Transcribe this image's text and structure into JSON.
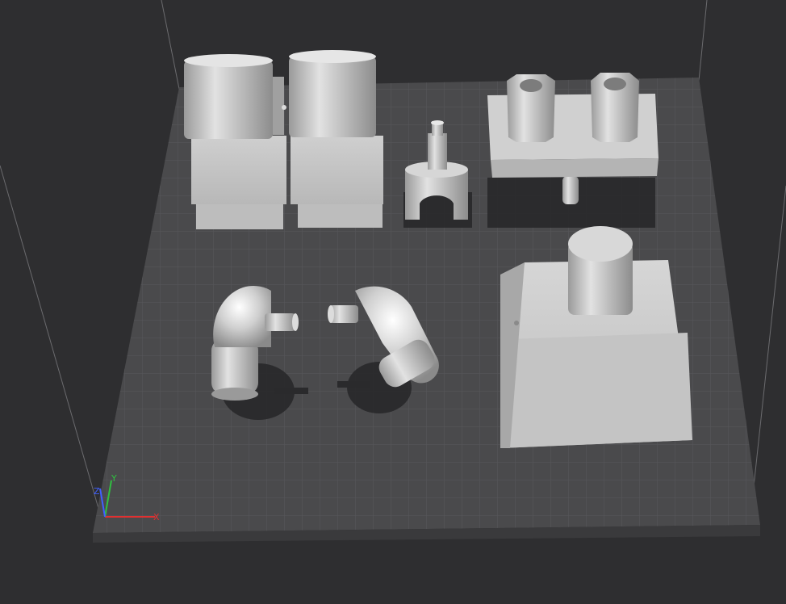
{
  "viewport": {
    "background": "#2e2e30",
    "bed_color": "#4a4a4c",
    "grid_color": "#5a5a5d",
    "model_color": "#c8c8c8"
  },
  "axes": {
    "x_label": "X",
    "y_label": "Y",
    "z_label": "Z",
    "x_color": "#e03030",
    "y_color": "#30c040",
    "z_color": "#4060ff"
  },
  "objects": [
    {
      "name": "cylinder-block-left"
    },
    {
      "name": "cylinder-block-right"
    },
    {
      "name": "clip-with-peg"
    },
    {
      "name": "hex-nut-plate"
    },
    {
      "name": "elbow-joint-left"
    },
    {
      "name": "elbow-joint-right"
    },
    {
      "name": "truncated-pyramid-with-cylinder"
    }
  ]
}
